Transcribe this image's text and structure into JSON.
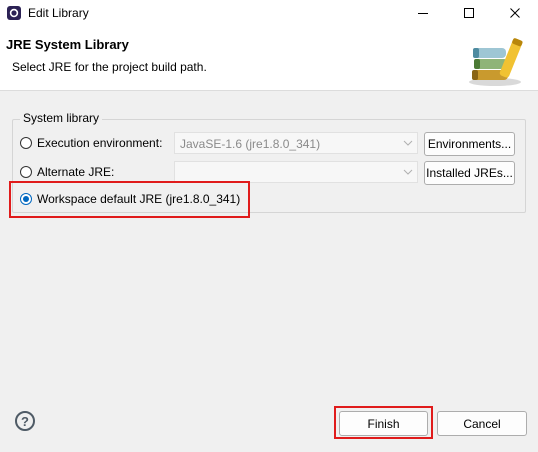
{
  "window": {
    "title": "Edit Library",
    "controls": [
      "minimize-icon",
      "maximize-icon",
      "close-icon"
    ]
  },
  "header": {
    "title": "JRE System Library",
    "subtitle": "Select JRE for the project build path."
  },
  "group": {
    "label": "System library",
    "options": {
      "execution_environment": {
        "label": "Execution environment:",
        "selected": false,
        "combo_value": "JavaSE-1.6 (jre1.8.0_341)",
        "button": "Environments..."
      },
      "alternate_jre": {
        "label": "Alternate JRE:",
        "selected": false,
        "combo_value": "",
        "button": "Installed JREs..."
      },
      "workspace_default": {
        "label": "Workspace default JRE (jre1.8.0_341)",
        "selected": true
      }
    }
  },
  "footer": {
    "finish_label": "Finish",
    "cancel_label": "Cancel",
    "help_label": "?"
  },
  "colors": {
    "highlight": "#e01b1b",
    "accent": "#0067c0"
  }
}
